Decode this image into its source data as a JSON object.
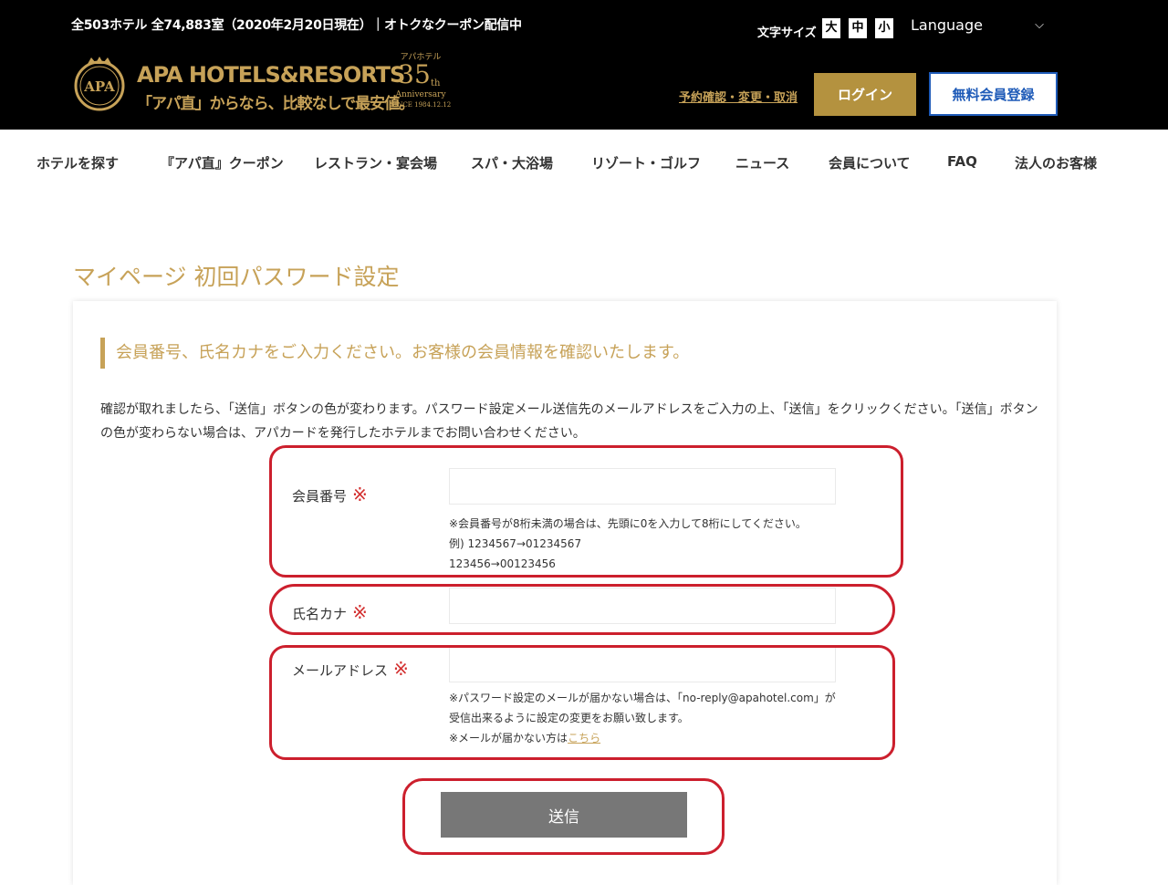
{
  "header": {
    "notice": "全503ホテル 全74,883室（2020年2月20日現在）｜オトクなクーポン配信中",
    "brand_name": "APA HOTELS&RESORTS",
    "brand_tagline": "「アパ直」からなら、比較なしで最安値。",
    "emblem_text": "APA",
    "anniversary": {
      "top": "アパホテル",
      "number": "35",
      "suffix": "th",
      "label": "Anniversary",
      "since": "SINCE 1984.12.12"
    },
    "font_size_label": "文字サイズ",
    "font_sizes": [
      "大",
      "中",
      "小"
    ],
    "language_label": "Language",
    "reservation_link": "予約確認・変更・取消",
    "login_label": "ログイン",
    "register_label": "無料会員登録"
  },
  "nav": {
    "items": [
      {
        "label": "ホテルを探す"
      },
      {
        "label": "『アパ直』クーポン"
      },
      {
        "label": "レストラン・宴会場"
      },
      {
        "label": "スパ・大浴場"
      },
      {
        "label": "リゾート・ゴルフ"
      },
      {
        "label": "ニュース"
      },
      {
        "label": "会員について"
      },
      {
        "label": "FAQ"
      },
      {
        "label": "法人のお客様"
      }
    ]
  },
  "page": {
    "title": "マイページ 初回パスワード設定",
    "section_heading": "会員番号、氏名カナをご入力ください。お客様の会員情報を確認いたします。",
    "description": "確認が取れましたら、「送信」ボタンの色が変わります。パスワード設定メール送信先のメールアドレスをご入力の上、「送信」をクリックください。「送信」ボタンの色が変わらない場合は、アパカードを発行したホテルまでお問い合わせください。"
  },
  "form": {
    "required_mark": "※",
    "member_number": {
      "label": "会員番号",
      "value": "",
      "hint_lines": [
        "※会員番号が8桁未満の場合は、先頭に0を入力して8桁にしてください。",
        "例) 1234567→01234567",
        "123456→00123456"
      ]
    },
    "name_kana": {
      "label": "氏名カナ",
      "value": ""
    },
    "email": {
      "label": "メールアドレス",
      "value": "",
      "hint_lines": [
        "※パスワード設定のメールが届かない場合は、「no-reply@apahotel.com」が",
        "受信出来るように設定の変更をお願い致します。"
      ],
      "hint_link_prefix": "※メールが届かない方は",
      "hint_link_text": "こちら"
    },
    "submit_label": "送信"
  },
  "colors": {
    "header_bg": "#000000",
    "gold": "#c7a258",
    "login_bg": "#b4923f",
    "register_text": "#1f5bb8",
    "submit_bg": "#777777",
    "required": "#d32f2f",
    "annotation_outline": "#cc1f2d"
  }
}
